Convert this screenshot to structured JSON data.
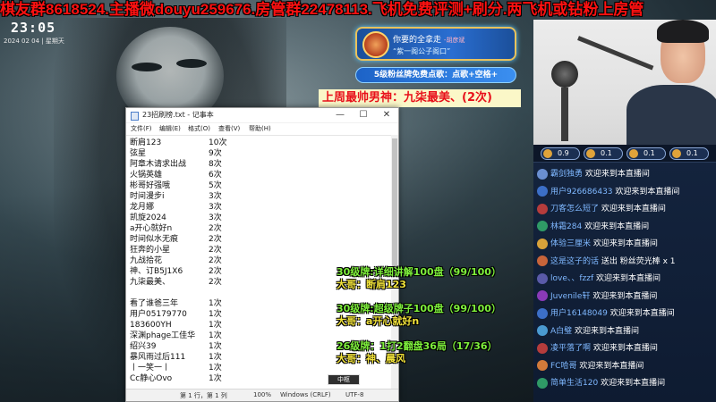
{
  "banner": {
    "text": "棋友群8618524.主播微douyu259676.房管群22478113.飞机免费评测+刷分.两飞机或钻粉上房管"
  },
  "clock": {
    "time": "23:05",
    "date": "2024 02 04 | 星期天"
  },
  "song_card": {
    "title": "你要的全拿走",
    "by": "-胡彦斌",
    "subtitle": "“紫一阁公子阁口”"
  },
  "fan_pill": "5级粉丝牌免费点歌：点歌+空格+",
  "last_week": "上周最帅男神：九柒最美、(2次)",
  "notepad": {
    "title": "23招刷榜.txt - 记事本",
    "menu": [
      "文件(F)",
      "编辑(E)",
      "格式(O)",
      "查看(V)",
      "帮助(H)"
    ],
    "rows": [
      {
        "name": "断肩123",
        "count": "10次"
      },
      {
        "name": "弦星",
        "count": "9次"
      },
      {
        "name": "阿章木请求出战",
        "count": "8次"
      },
      {
        "name": "火锅英雄",
        "count": "6次"
      },
      {
        "name": "彬哥好强哦",
        "count": "5次"
      },
      {
        "name": "时间漫步i",
        "count": "3次"
      },
      {
        "name": "龙月娜",
        "count": "3次"
      },
      {
        "name": "凯旋2024",
        "count": "3次"
      },
      {
        "name": "a开心就好n",
        "count": "2次"
      },
      {
        "name": "时间似水无痕",
        "count": "2次"
      },
      {
        "name": "狂奔的小星",
        "count": "2次"
      },
      {
        "name": "九战拾花",
        "count": "2次"
      },
      {
        "name": "神、订B5J1X6",
        "count": "2次"
      },
      {
        "name": "九柒最美、",
        "count": "2次"
      },
      {
        "name": "",
        "count": ""
      },
      {
        "name": "看了谁爸三年",
        "count": "1次"
      },
      {
        "name": "用户05179770",
        "count": "1次"
      },
      {
        "name": "183600YH",
        "count": "1次"
      },
      {
        "name": "深渊phage工佳华",
        "count": "1次"
      },
      {
        "name": "绍兴39",
        "count": "1次"
      },
      {
        "name": "暴风雨过后111",
        "count": "1次"
      },
      {
        "name": "丨一笑一丨",
        "count": "1次"
      },
      {
        "name": "Cc静心Ovo",
        "count": "1次"
      }
    ],
    "status": {
      "pos": "第 1 行，第 1 列",
      "zoom": "100%",
      "eol": "Windows (CRLF)",
      "enc": "UTF-8"
    }
  },
  "green_overlay": [
    {
      "line1": "30级牌:详细讲解100盘（99/100）",
      "line2": "大哥：断肩123"
    },
    {
      "line1": "30级牌:超级牌子100盘（99/100）",
      "line2": "大哥：a开心就好n"
    },
    {
      "line1": "26级牌：1打2翻盘36局（17/36）",
      "line2": "大哥：神、晨风"
    }
  ],
  "tiny_badge": "中枢",
  "chat": {
    "ranks": [
      "0.9",
      "0.1",
      "0.1",
      "0.1"
    ],
    "messages": [
      {
        "name": "霸剑独勇",
        "text": "欢迎来到本直播间",
        "av": "#6a8fd1"
      },
      {
        "name": "用户926686433",
        "text": "欢迎来到本直播间",
        "av": "#3c6fc7"
      },
      {
        "name": "刀客怎么短了",
        "text": "欢迎来到本直播间",
        "av": "#b53c3c"
      },
      {
        "name": "林霜284",
        "text": "欢迎来到本直播间",
        "av": "#2f9a66"
      },
      {
        "name": "体验三厘米",
        "text": "欢迎来到本直播间",
        "av": "#d8a23a"
      },
      {
        "name": "这是这子的话",
        "text": "送出 粉丝荧光棒 x 1",
        "av": "#c7643a"
      },
      {
        "name": "love、、fzzf",
        "text": "欢迎来到本直播间",
        "av": "#5a5aa8"
      },
      {
        "name": "Juvenile轩",
        "text": "欢迎来到本直播间",
        "av": "#8a3ab8"
      },
      {
        "name": "用户16148049",
        "text": "欢迎来到本直播间",
        "av": "#3c6fc7"
      },
      {
        "name": "A白璧",
        "text": "欢迎来到本直播间",
        "av": "#4a9ad1"
      },
      {
        "name": "凌平落了啊",
        "text": "欢迎来到本直播间",
        "av": "#b53c3c"
      },
      {
        "name": "FC哈哥",
        "text": "欢迎来到本直播间",
        "av": "#d17a3a"
      },
      {
        "name": "简单生活120",
        "text": "欢迎来到本直播间",
        "av": "#2f9a66"
      }
    ]
  }
}
